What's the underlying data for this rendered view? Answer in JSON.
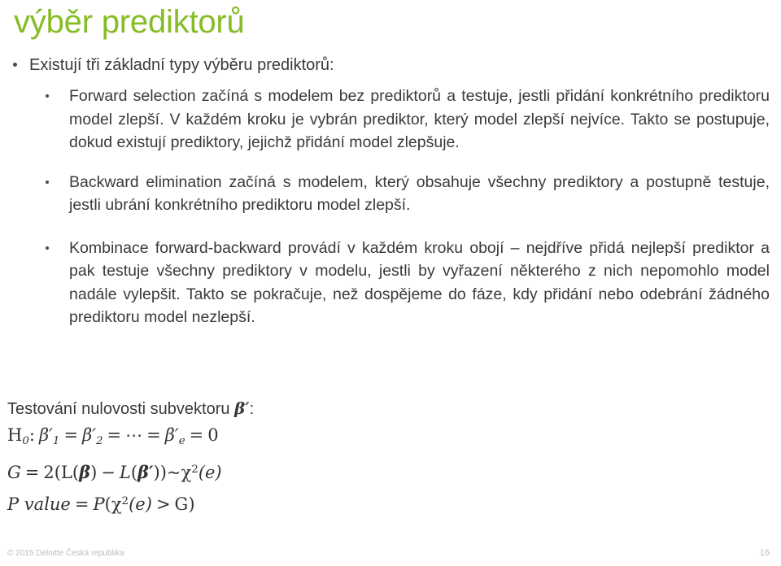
{
  "slide": {
    "title": "výběr prediktorů",
    "title_color": "#86BC25",
    "body_text_color": "#3A3A3A",
    "background_color": "#FFFFFF"
  },
  "content": {
    "lead_bullet": "Existují tři základní typy výběru prediktorů:",
    "sub_bullets": [
      "Forward selection začíná s modelem bez prediktorů a testuje, jestli přidání konkrétního prediktoru model zlepší. V každém kroku je vybrán prediktor, který model zlepší nejvíce. Takto se postupuje, dokud existují prediktory, jejichž přidání model zlepšuje.",
      "Backward elimination začíná s modelem, který obsahuje všechny prediktory a postupně testuje, jestli ubrání konkrétního prediktoru model zlepší.",
      "Kombinace forward-backward provádí v každém kroku obojí – nejdříve přidá nejlepší prediktor a pak testuje všechny prediktory v modelu, jestli by vyřazení některého z nich nepomohlo model nadále vylepšit. Takto se pokračuje, než dospějeme do fáze, kdy přidání nebo odebrání žádného prediktoru model nezlepší."
    ]
  },
  "math": {
    "lead_prefix": "Testování nulovosti subvektoru ",
    "lead_symbol": "β′",
    "lead_suffix": ":",
    "equation_1": "H₀: β′₁ = β′₂ = ⋯ = β′ₑ = 0",
    "equation_2": "G = 2(L(β) − L(β′))~χ²(e)",
    "equation_3": "P value = P(χ²(e) > G)",
    "eq1_parts": {
      "h": "H",
      "h_sub": "0",
      "colon": ":",
      "beta": "β′",
      "sub1": "1",
      "eq": "=",
      "sub2": "2",
      "dots": "⋯",
      "sub_e": "e",
      "zero": "0"
    },
    "eq2_parts": {
      "g": "G",
      "eq": "=",
      "two": "2(",
      "L_upright": "L",
      "open": "(",
      "beta": "β",
      "close": ")",
      "minus": "−",
      "L_italic": "L",
      "beta_prime": "β′",
      "close2": "))",
      "tilde": "~",
      "chi": "χ",
      "sup2": "2",
      "e_arg": "(e)"
    },
    "eq3_parts": {
      "pvalue": "P value",
      "eq": "=",
      "p": "P",
      "open": "(",
      "chi": "χ",
      "sup2": "2",
      "e_arg": "(e)",
      "gt": ">",
      "g": "G",
      "close": ")"
    }
  },
  "footer": {
    "copyright": "© 2015 Deloitte Česká republika",
    "page_number": "16"
  }
}
